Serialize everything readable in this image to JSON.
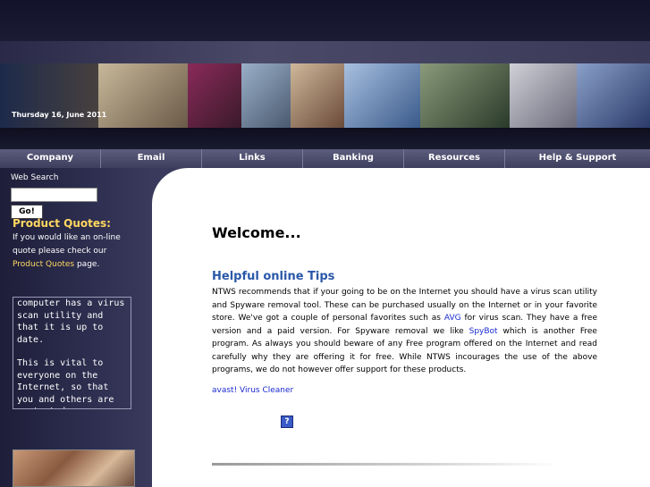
{
  "header": {
    "date": "Thursday 16, June 2011"
  },
  "nav": {
    "items": [
      "Company",
      "Email",
      "Links",
      "Banking",
      "Resources",
      "Help & Support"
    ]
  },
  "sidebar": {
    "web_search_label": "Web Search",
    "search_value": "",
    "go_label": "Go!",
    "product_quotes_title": "Product Quotes:",
    "product_quotes_text_1": "If you would like an on-line quote please check our",
    "product_quotes_link": "Product Quotes",
    "product_quotes_text_2": "page.",
    "scroller_p1": "computer has a virus scan utility and that it is up to date.",
    "scroller_p2": "This is vital to everyone on the Internet, so that you and others are protected."
  },
  "main": {
    "welcome": "Welcome...",
    "tips_title": "Helpful online Tips",
    "tips_part1": "NTWS recommends that if your going to be on the Internet you should have a virus scan utility and Spyware removal tool. These can be purchased usually on the Internet or in your favorite store. We've got a couple of personal favorites such as",
    "tips_link_avg": "AVG",
    "tips_part2": "for virus scan. They have a free version and a paid version. For Spyware removal we like",
    "tips_link_spybot": "SpyBot",
    "tips_part3": "which is another Free program. As always you should beware of any Free program offered on the Internet and read carefully why they are offering it for free. While NTWS incourages the use of the above programs, we do not however offer support for these products.",
    "avast_link": "avast! Virus Cleaner",
    "help_icon_glyph": "?"
  },
  "colors": {
    "accent_yellow": "#ffd860",
    "link_blue": "#1a2ad0",
    "title_blue": "#2a58a8",
    "sidebar_dark": "#1e1e3a"
  }
}
